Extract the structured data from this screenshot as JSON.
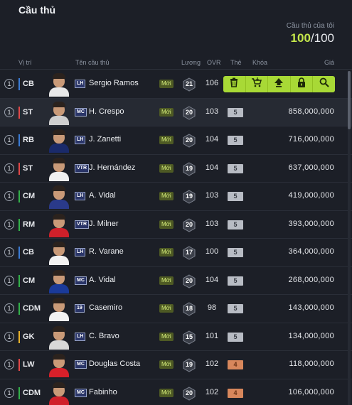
{
  "header": {
    "title": "Cầu thủ",
    "count_label": "Cầu thủ của tôi",
    "count_current": "100",
    "count_max": "/100"
  },
  "columns": {
    "position": "Vị trí",
    "name": "Tên cầu thủ",
    "wage": "Lương",
    "ovr": "OVR",
    "card": "Thẻ",
    "lock": "Khóa",
    "price": "Giá"
  },
  "new_label": "Mới",
  "action_icons": [
    "trash-icon",
    "sell-cart-icon",
    "upgrade-icon",
    "lock-icon",
    "search-icon"
  ],
  "players": [
    {
      "num": "1",
      "pos": "CB",
      "line": "def",
      "season": "LH",
      "name": "Sergio Ramos",
      "wage": "21",
      "ovr": "106",
      "card": "",
      "price": "",
      "kit": "#e8e8e8"
    },
    {
      "num": "1",
      "pos": "ST",
      "line": "att",
      "season": "MC",
      "name": "H. Crespo",
      "wage": "20",
      "ovr": "103",
      "card": "5",
      "price": "858,000,000",
      "kit": "#cfcfcf"
    },
    {
      "num": "1",
      "pos": "RB",
      "line": "def",
      "season": "LH",
      "name": "J. Zanetti",
      "wage": "20",
      "ovr": "104",
      "card": "5",
      "price": "716,000,000",
      "kit": "#1a2a6a"
    },
    {
      "num": "1",
      "pos": "ST",
      "line": "att",
      "season": "VTR",
      "name": "J. Hernández",
      "wage": "19",
      "ovr": "104",
      "card": "5",
      "price": "637,000,000",
      "kit": "#f0f0f0"
    },
    {
      "num": "1",
      "pos": "CM",
      "line": "mid",
      "season": "LH",
      "name": "A. Vidal",
      "wage": "19",
      "ovr": "103",
      "card": "5",
      "price": "419,000,000",
      "kit": "#2a3a8a"
    },
    {
      "num": "1",
      "pos": "RM",
      "line": "mid",
      "season": "VTR",
      "name": "J. Milner",
      "wage": "20",
      "ovr": "103",
      "card": "5",
      "price": "393,000,000",
      "kit": "#d0202a"
    },
    {
      "num": "1",
      "pos": "CB",
      "line": "def",
      "season": "LH",
      "name": "R. Varane",
      "wage": "17",
      "ovr": "100",
      "card": "5",
      "price": "364,000,000",
      "kit": "#f2f2f2"
    },
    {
      "num": "1",
      "pos": "CM",
      "line": "mid",
      "season": "MC",
      "name": "A. Vidal",
      "wage": "20",
      "ovr": "104",
      "card": "5",
      "price": "268,000,000",
      "kit": "#1a3a9a"
    },
    {
      "num": "1",
      "pos": "CDM",
      "line": "mid",
      "season": "19",
      "name": "Casemiro",
      "wage": "18",
      "ovr": "98",
      "card": "5",
      "price": "143,000,000",
      "kit": "#f2f2f2"
    },
    {
      "num": "1",
      "pos": "GK",
      "line": "gk",
      "season": "LH",
      "name": "C. Bravo",
      "wage": "15",
      "ovr": "101",
      "card": "5",
      "price": "134,000,000",
      "kit": "#d8d8d8"
    },
    {
      "num": "1",
      "pos": "LW",
      "line": "att",
      "season": "MC",
      "name": "Douglas Costa",
      "wage": "19",
      "ovr": "102",
      "card": "4",
      "price": "118,000,000",
      "kit": "#d8202a"
    },
    {
      "num": "1",
      "pos": "CDM",
      "line": "mid",
      "season": "MC",
      "name": "Fabinho",
      "wage": "20",
      "ovr": "102",
      "card": "4",
      "price": "106,000,000",
      "kit": "#d0202a"
    }
  ]
}
